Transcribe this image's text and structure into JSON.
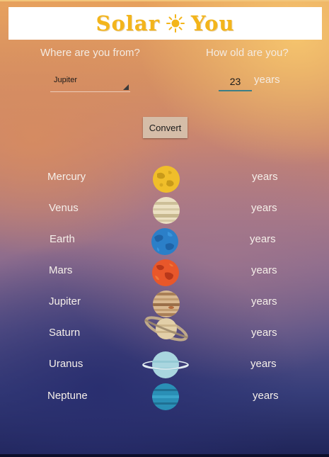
{
  "header": {
    "title_left": "Solar",
    "title_right": "You",
    "icon": "sun-icon"
  },
  "form": {
    "from_label": "Where are you from?",
    "age_label": "How old are you?",
    "planet_select_value": "Jupiter",
    "age_value": "23",
    "age_unit": "years",
    "convert_label": "Convert"
  },
  "planets": [
    {
      "name": "Mercury",
      "unit": "years",
      "icon": "mercury-icon"
    },
    {
      "name": "Venus",
      "unit": "years",
      "icon": "venus-icon"
    },
    {
      "name": "Earth",
      "unit": "years",
      "icon": "earth-icon"
    },
    {
      "name": "Mars",
      "unit": "years",
      "icon": "mars-icon"
    },
    {
      "name": "Jupiter",
      "unit": "years",
      "icon": "jupiter-icon"
    },
    {
      "name": "Saturn",
      "unit": "years",
      "icon": "saturn-icon"
    },
    {
      "name": "Uranus",
      "unit": "years",
      "icon": "uranus-icon"
    },
    {
      "name": "Neptune",
      "unit": "years",
      "icon": "neptune-icon"
    }
  ],
  "colors": {
    "title": "#f3b51b",
    "input_underline": "#3c7f86",
    "button": "#d5bda8",
    "text_light": "#f5efe9"
  }
}
